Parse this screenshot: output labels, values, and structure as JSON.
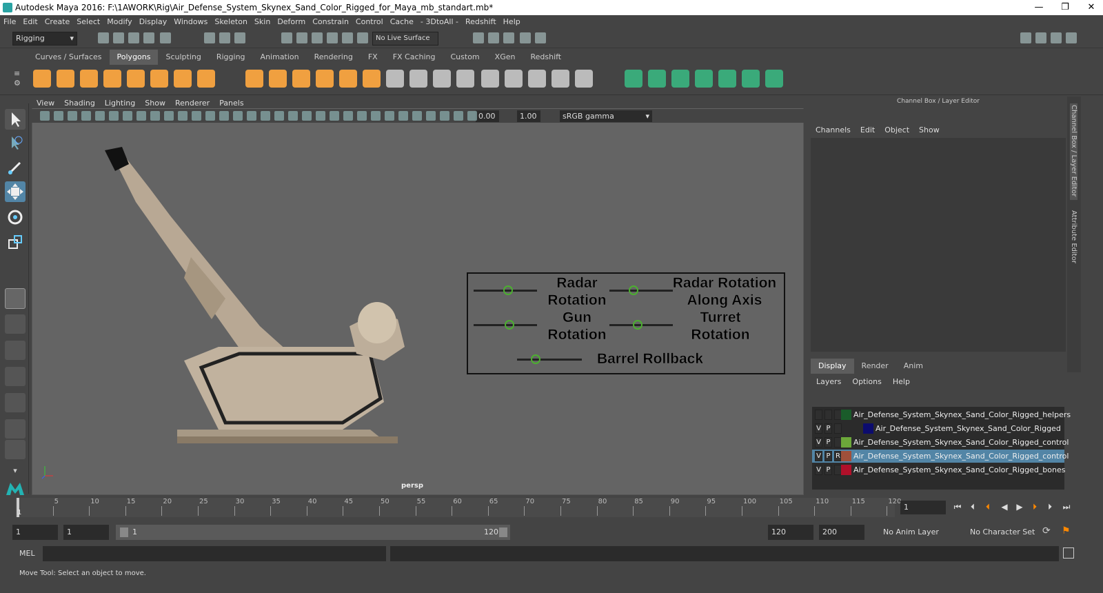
{
  "window": {
    "title": "Autodesk Maya 2016: F:\\1AWORK\\Rig\\Air_Defense_System_Skynex_Sand_Color_Rigged_for_Maya_mb_standart.mb*",
    "minimize": "—",
    "maximize": "❐",
    "close": "✕"
  },
  "menu": [
    "File",
    "Edit",
    "Create",
    "Select",
    "Modify",
    "Display",
    "Windows",
    "Skeleton",
    "Skin",
    "Deform",
    "Constrain",
    "Control",
    "Cache",
    "- 3DtoAll -",
    "Redshift",
    "Help"
  ],
  "status": {
    "mode": "Rigging",
    "live_surface": "No Live Surface"
  },
  "shelf_tabs": [
    "Curves / Surfaces",
    "Polygons",
    "Sculpting",
    "Rigging",
    "Animation",
    "Rendering",
    "FX",
    "FX Caching",
    "Custom",
    "XGen",
    "Redshift"
  ],
  "shelf_active": "Polygons",
  "viewport": {
    "menu": [
      "View",
      "Shading",
      "Lighting",
      "Show",
      "Renderer",
      "Panels"
    ],
    "exposure": "0.00",
    "gamma": "1.00",
    "colorspace": "sRGB gamma",
    "camera": "persp"
  },
  "controls": {
    "radar_rotation": "Radar\nRotation",
    "radar_axis": "Radar Rotation\nAlong Axis",
    "gun_rotation": "Gun\nRotation",
    "turret_rotation": "Turret\nRotation",
    "barrel_rollback": "Barrel Rollback"
  },
  "channel_box": {
    "header": "Channel Box / Layer Editor",
    "menu": [
      "Channels",
      "Edit",
      "Object",
      "Show"
    ]
  },
  "layer_editor": {
    "tabs": [
      "Display",
      "Render",
      "Anim"
    ],
    "active_tab": "Display",
    "menu": [
      "Layers",
      "Options",
      "Help"
    ],
    "layers": [
      {
        "v": "",
        "p": "",
        "r": "",
        "color": "#1a5c2a",
        "name": "Air_Defense_System_Skynex_Sand_Color_Rigged_helpers"
      },
      {
        "v": "V",
        "p": "P",
        "r": "",
        "color": "#0c0c6e",
        "name": "Air_Defense_System_Skynex_Sand_Color_Rigged"
      },
      {
        "v": "V",
        "p": "P",
        "r": "",
        "color": "#6ca83a",
        "name": "Air_Defense_System_Skynex_Sand_Color_Rigged_control"
      },
      {
        "v": "V",
        "p": "P",
        "r": "R",
        "color": "#a0503a",
        "name": "Air_Defense_System_Skynex_Sand_Color_Rigged_control"
      },
      {
        "v": "V",
        "p": "P",
        "r": "",
        "color": "#b0102a",
        "name": "Air_Defense_System_Skynex_Sand_Color_Rigged_bones"
      }
    ]
  },
  "side_tabs": {
    "channel": "Channel Box / Layer Editor",
    "attr": "Attribute Editor"
  },
  "timeline": {
    "ticks": [
      "5",
      "10",
      "15",
      "20",
      "25",
      "30",
      "35",
      "40",
      "45",
      "50",
      "55",
      "60",
      "65",
      "70",
      "75",
      "80",
      "85",
      "90",
      "95",
      "100",
      "105",
      "110",
      "115",
      "120"
    ],
    "current": "1",
    "frame_field": "1"
  },
  "range": {
    "start": "1",
    "start2": "1",
    "slider_start": "1",
    "slider_end": "120",
    "end": "120",
    "end2": "200",
    "anim_layer": "No Anim Layer",
    "char_set": "No Character Set"
  },
  "cmd": {
    "label": "MEL"
  },
  "help": "Move Tool: Select an object to move."
}
